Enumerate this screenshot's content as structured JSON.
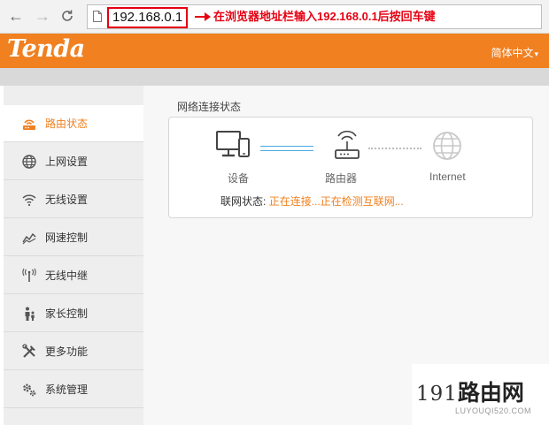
{
  "browser": {
    "url": "192.168.0.1",
    "annotation": "在浏览器地址栏输入192.168.0.1后按回车键",
    "back_glyph": "←",
    "forward_glyph": "→",
    "reload_glyph": "C"
  },
  "header": {
    "logo": "Tenda",
    "language": "简体中文",
    "brand_color": "#f08020"
  },
  "sidebar": {
    "items": [
      {
        "label": "路由状态",
        "icon": "router-status-icon",
        "active": true
      },
      {
        "label": "上网设置",
        "icon": "globe-icon",
        "active": false
      },
      {
        "label": "无线设置",
        "icon": "wifi-icon",
        "active": false
      },
      {
        "label": "网速控制",
        "icon": "speed-chart-icon",
        "active": false
      },
      {
        "label": "无线中继",
        "icon": "antenna-icon",
        "active": false
      },
      {
        "label": "家长控制",
        "icon": "family-icon",
        "active": false
      },
      {
        "label": "更多功能",
        "icon": "tools-icon",
        "active": false
      },
      {
        "label": "系统管理",
        "icon": "gears-icon",
        "active": false
      }
    ]
  },
  "main": {
    "section_title": "网络连接状态",
    "device_label": "设备",
    "router_label": "路由器",
    "internet_label": "Internet",
    "status_key": "联网状态:",
    "status_value": "正在连接...正在检测互联网...",
    "status_color": "#f08020"
  },
  "watermark": {
    "number": "191",
    "name": "路由网",
    "site": "LUYOUQI520.COM"
  }
}
